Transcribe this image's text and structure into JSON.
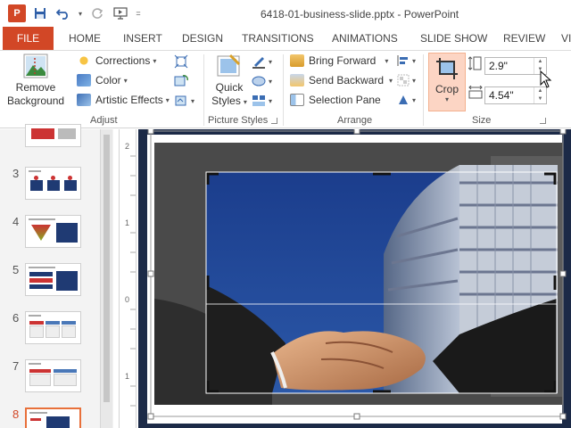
{
  "window": {
    "title": "6418-01-business-slide.pptx - PowerPoint",
    "app_icon": "P"
  },
  "tabs": [
    {
      "label": "FILE"
    },
    {
      "label": "HOME"
    },
    {
      "label": "INSERT"
    },
    {
      "label": "DESIGN"
    },
    {
      "label": "TRANSITIONS"
    },
    {
      "label": "ANIMATIONS"
    },
    {
      "label": "SLIDE SHOW"
    },
    {
      "label": "REVIEW"
    },
    {
      "label": "VI"
    }
  ],
  "ribbon": {
    "adjust": {
      "label": "Adjust",
      "remove_background_line1": "Remove",
      "remove_background_line2": "Background",
      "corrections": "Corrections",
      "color": "Color",
      "artistic_effects": "Artistic Effects"
    },
    "picture_styles": {
      "label": "Picture Styles",
      "quick_styles_line1": "Quick",
      "quick_styles_line2": "Styles"
    },
    "arrange": {
      "label": "Arrange",
      "bring_forward": "Bring Forward",
      "send_backward": "Send Backward",
      "selection_pane": "Selection Pane"
    },
    "size": {
      "label": "Size",
      "crop": "Crop",
      "height_value": "2.9\"",
      "width_value": "4.54\""
    }
  },
  "slides": [
    {
      "number": "3"
    },
    {
      "number": "4"
    },
    {
      "number": "5"
    },
    {
      "number": "6"
    },
    {
      "number": "7"
    },
    {
      "number": "8"
    }
  ],
  "ruler": {
    "marks": [
      "2",
      "1",
      "0",
      "1",
      "2"
    ]
  }
}
